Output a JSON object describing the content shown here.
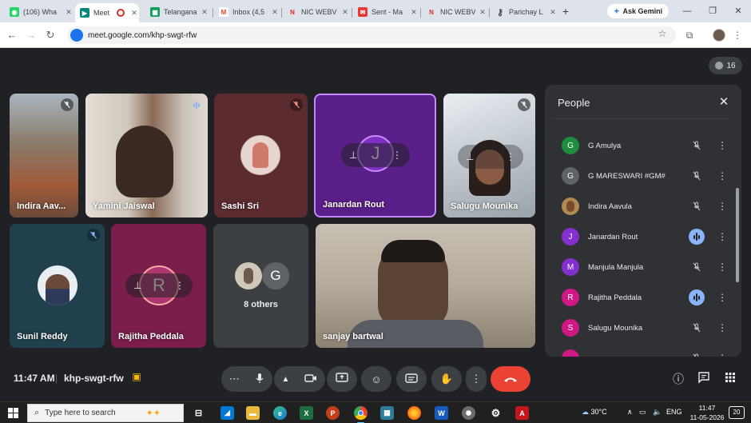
{
  "browser": {
    "tabs": [
      {
        "title": "(106) Wha",
        "icon": "whatsapp-icon",
        "color": "#25d366"
      },
      {
        "title": "Meet",
        "icon": "meet-icon",
        "color": "#00897b",
        "active": true,
        "recording": true
      },
      {
        "title": "Telangana",
        "icon": "sheets-icon",
        "color": "#0f9d58"
      },
      {
        "title": "Inbox (4,5",
        "icon": "gmail-icon",
        "color": "#ea4335"
      },
      {
        "title": "NIC WEBV",
        "icon": "nic-icon",
        "color": "#d93025"
      },
      {
        "title": "Sent - Ma",
        "icon": "mail-icon",
        "color": "#e53935"
      },
      {
        "title": "NIC WEBV",
        "icon": "nic-icon",
        "color": "#d93025"
      },
      {
        "title": "Parichay L",
        "icon": "key-icon",
        "color": "#5f6368"
      }
    ],
    "new_tab_label": "+",
    "gemini_label": "Ask Gemini",
    "url": "meet.google.com/khp-swgt-rfw"
  },
  "meet": {
    "participant_count": "16",
    "tiles": [
      {
        "name": "Indira Aav...",
        "mic": "muted"
      },
      {
        "name": "Yamini Jaiswal",
        "mic": "speaking"
      },
      {
        "name": "Sashi Sri",
        "mic": "muted"
      },
      {
        "name": "Janardan Rout",
        "mic": "none",
        "initial": "J"
      },
      {
        "name": "Salugu Mounika",
        "mic": "muted"
      },
      {
        "name": "Sunil Reddy",
        "mic": "muted"
      },
      {
        "name": "Rajitha Peddala",
        "mic": "none",
        "initial": "R"
      },
      {
        "name": "8 others",
        "initial": "G"
      },
      {
        "name": "sanjay bartwal",
        "mic": "none"
      }
    ],
    "people_panel": {
      "title": "People",
      "participants": [
        {
          "name": "G Amulya",
          "initial": "G",
          "color": "#1e8e3e",
          "mic": "muted"
        },
        {
          "name": "G MARESWARI #GM#",
          "initial": "G",
          "color": "#5f6368",
          "mic": "muted"
        },
        {
          "name": "Indira Aavula",
          "initial": "",
          "color": "#b08a50",
          "mic": "muted"
        },
        {
          "name": "Janardan Rout",
          "initial": "J",
          "color": "#8430ce",
          "mic": "speaking"
        },
        {
          "name": "Manjula Manjula",
          "initial": "M",
          "color": "#8430ce",
          "mic": "muted"
        },
        {
          "name": "Rajitha Peddala",
          "initial": "R",
          "color": "#d01884",
          "mic": "speaking"
        },
        {
          "name": "Salugu Mounika",
          "initial": "S",
          "color": "#d01884",
          "mic": "muted"
        },
        {
          "name": "",
          "initial": "",
          "color": "#d01884",
          "mic": "muted"
        }
      ]
    },
    "controls": {
      "time": "11:47 AM",
      "separator": "|",
      "meeting_code": "khp-swgt-rfw"
    }
  },
  "taskbar": {
    "search_placeholder": "Type here to search",
    "weather": "30°C",
    "language": "ENG",
    "time": "11:47",
    "date": "11-05-2026",
    "notifications": "20"
  }
}
